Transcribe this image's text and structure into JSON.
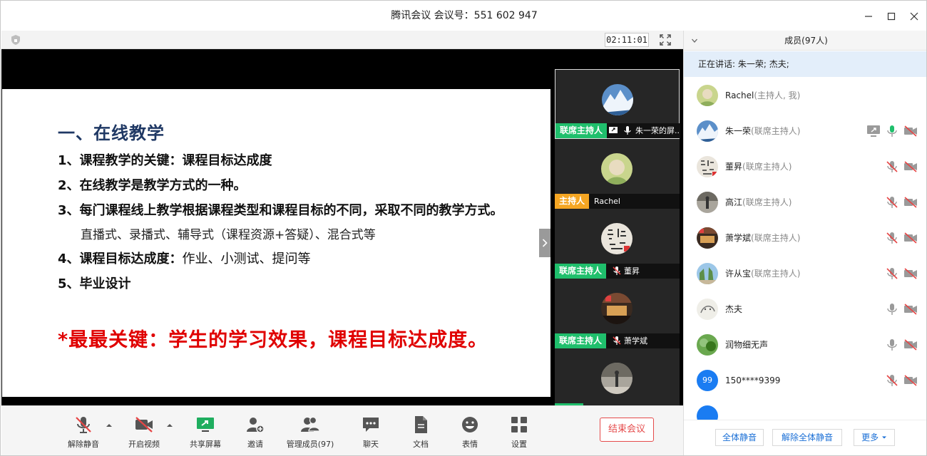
{
  "window": {
    "title": "腾讯会议 会议号：551 602 947"
  },
  "stage": {
    "timer": "02:11:01"
  },
  "slide": {
    "heading": "一、在线教学",
    "line1": "1、课程教学的关键：课程目标达成度",
    "line2": "2、在线教学是教学方式的一种。",
    "line3": "3、每门课程线上教学根据课程类型和课程目标的不同，采取不同的教学方式。",
    "line3_sub": "直播式、录播式、辅导式（课程资源+答疑）、混合式等",
    "line4_bold": "4、课程目标达成度：",
    "line4_normal": "作业、小测试、提问等",
    "line5": "5、毕业设计",
    "key": "*最最关键：学生的学习效果，课程目标达成度。"
  },
  "thumbnails": [
    {
      "role": "联席主持人",
      "name": "朱一荣的屏...",
      "role_color": "#1fbf6c"
    },
    {
      "role": "主持人",
      "name": "Rachel",
      "role_color": "#f5a623"
    },
    {
      "role": "联席主持人",
      "name": "董昇",
      "role_color": "#1fbf6c"
    },
    {
      "role": "联席主持人",
      "name": "萧学斌",
      "role_color": "#1fbf6c"
    }
  ],
  "toolbar": {
    "mute": "解除静音",
    "video": "开启视频",
    "share": "共享屏幕",
    "invite": "邀请",
    "manage": "管理成员(97)",
    "chat": "聊天",
    "docs": "文档",
    "emoji": "表情",
    "settings": "设置",
    "end": "结束会议"
  },
  "panel": {
    "title": "成员(97人)",
    "speaking": "正在讲话: 朱一荣; 杰夫;",
    "members": [
      {
        "name": "Rachel",
        "role": "(主持人, 我)"
      },
      {
        "name": "朱一荣",
        "role": "(联席主持人)"
      },
      {
        "name": "董昇",
        "role": "(联席主持人)"
      },
      {
        "name": "高江",
        "role": "(联席主持人)"
      },
      {
        "name": "萧学斌",
        "role": "(联席主持人)"
      },
      {
        "name": "许从宝",
        "role": "(联席主持人)"
      },
      {
        "name": "杰夫",
        "role": ""
      },
      {
        "name": "润物细无声",
        "role": ""
      },
      {
        "name": "150****9399",
        "role": "",
        "avatar_text": "99"
      }
    ],
    "mute_all": "全体静音",
    "unmute_all": "解除全体静音",
    "more": "更多"
  },
  "colors": {
    "accent_green": "#1fbf6c",
    "host_orange": "#f5a623",
    "end_red": "#e54b4b",
    "key_red": "#e00000",
    "muted_red": "#e64545"
  }
}
